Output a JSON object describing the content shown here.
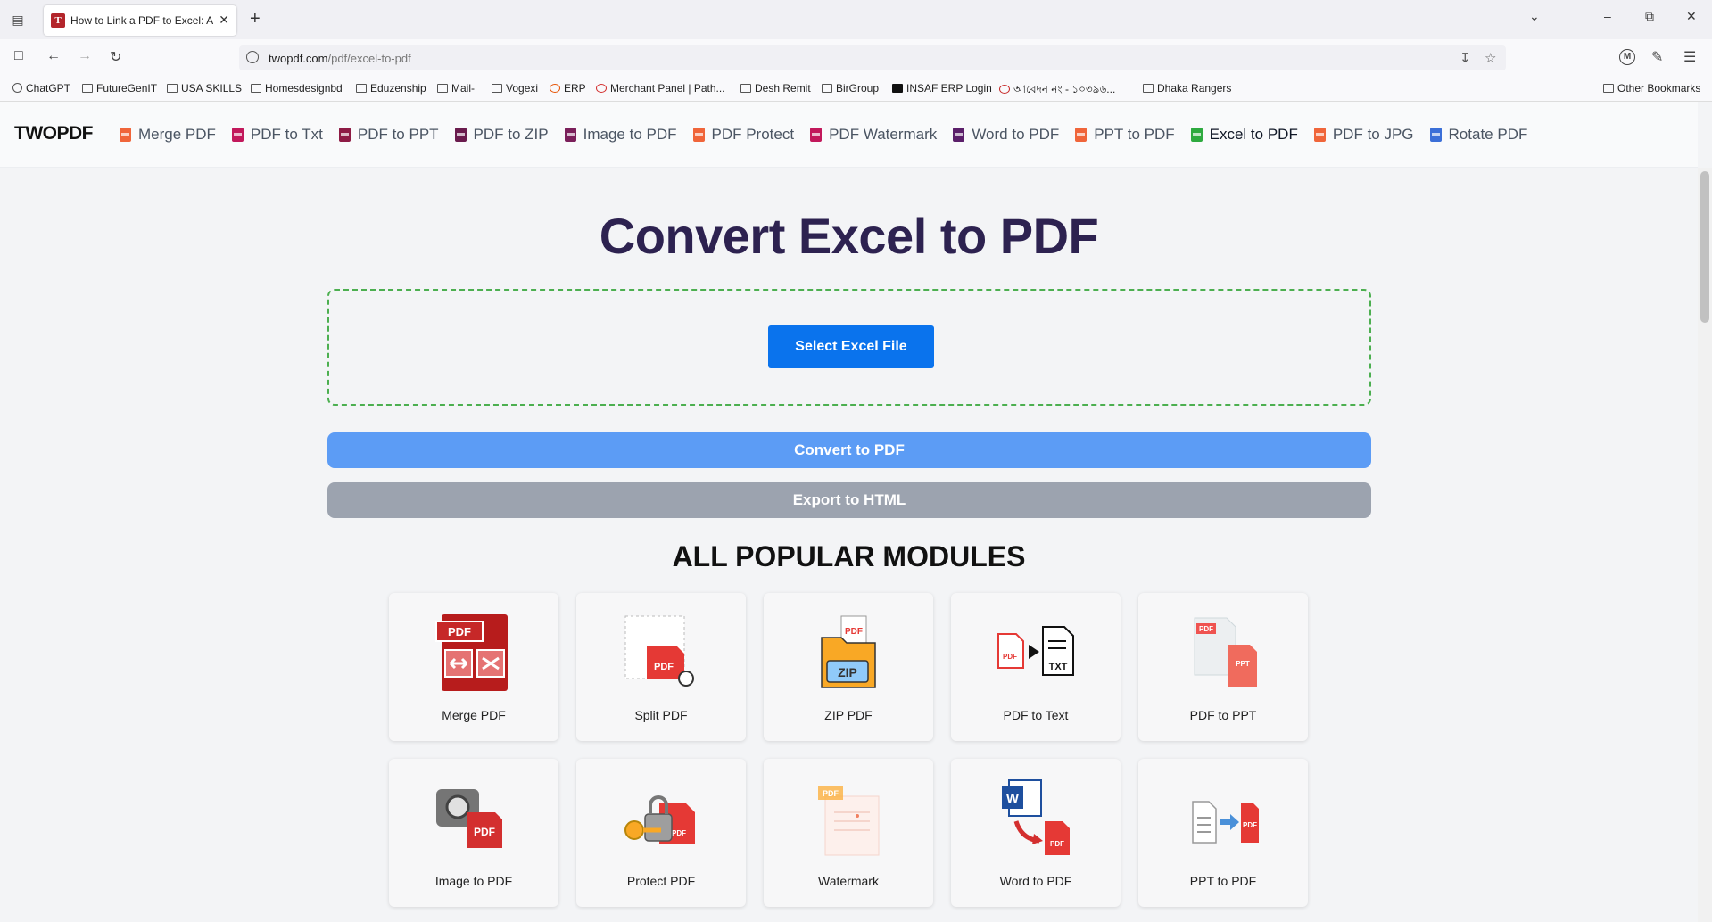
{
  "browser": {
    "tab_title": "How to Link a PDF to Excel: A St",
    "url_host": "twopdf.com",
    "url_path": "/pdf/excel-to-pdf",
    "bookmarks": [
      "ChatGPT",
      "FutureGenIT",
      "USA SKILLS",
      "Homesdesignbd",
      "Eduzenship",
      "Mail-",
      "Vogexi",
      "ERP",
      "Merchant Panel | Path...",
      "Desh Remit",
      "BirGroup",
      "INSAF ERP Login",
      "আবেদন নং - ১০৩৯৬...",
      "Dhaka Rangers"
    ],
    "other_bookmarks": "Other Bookmarks",
    "profile_initial": "M"
  },
  "site": {
    "logo": "TWOPDF",
    "menu": [
      {
        "label": "Merge PDF",
        "color": "#f0653a"
      },
      {
        "label": "PDF to Txt",
        "color": "#c2185b"
      },
      {
        "label": "PDF to PPT",
        "color": "#8e1b45"
      },
      {
        "label": "PDF to ZIP",
        "color": "#6a1b4d"
      },
      {
        "label": "Image to PDF",
        "color": "#7b1f5a"
      },
      {
        "label": "PDF Protect",
        "color": "#f0653a"
      },
      {
        "label": "PDF Watermark",
        "color": "#c2185b"
      },
      {
        "label": "Word to PDF",
        "color": "#5b1f6a"
      },
      {
        "label": "PPT to PDF",
        "color": "#f0653a"
      },
      {
        "label": "Excel to PDF",
        "color": "#2eaa3f"
      },
      {
        "label": "PDF to JPG",
        "color": "#f0653a"
      },
      {
        "label": "Rotate PDF",
        "color": "#3b6fd8"
      }
    ],
    "active_menu": "Excel to PDF"
  },
  "main": {
    "title": "Convert Excel to PDF",
    "select_button": "Select Excel File",
    "convert_button": "Convert to PDF",
    "export_button": "Export to HTML",
    "section_title": "ALL POPULAR MODULES",
    "modules": [
      {
        "label": "Merge PDF",
        "icon": "merge-pdf-icon"
      },
      {
        "label": "Split PDF",
        "icon": "split-pdf-icon"
      },
      {
        "label": "ZIP PDF",
        "icon": "zip-pdf-icon"
      },
      {
        "label": "PDF to Text",
        "icon": "pdf-to-text-icon"
      },
      {
        "label": "PDF to PPT",
        "icon": "pdf-to-ppt-icon"
      },
      {
        "label": "Image to PDF",
        "icon": "image-to-pdf-icon"
      },
      {
        "label": "Protect PDF",
        "icon": "protect-pdf-icon"
      },
      {
        "label": "Watermark",
        "icon": "watermark-icon"
      },
      {
        "label": "Word to PDF",
        "icon": "word-to-pdf-icon"
      },
      {
        "label": "PPT to PDF",
        "icon": "ppt-to-pdf-icon"
      }
    ]
  },
  "colors": {
    "primary": "#0a73ed",
    "convert": "#5c9cf5",
    "export": "#9ca3af",
    "title": "#2d2250",
    "dropzone_border": "#4caf50"
  }
}
